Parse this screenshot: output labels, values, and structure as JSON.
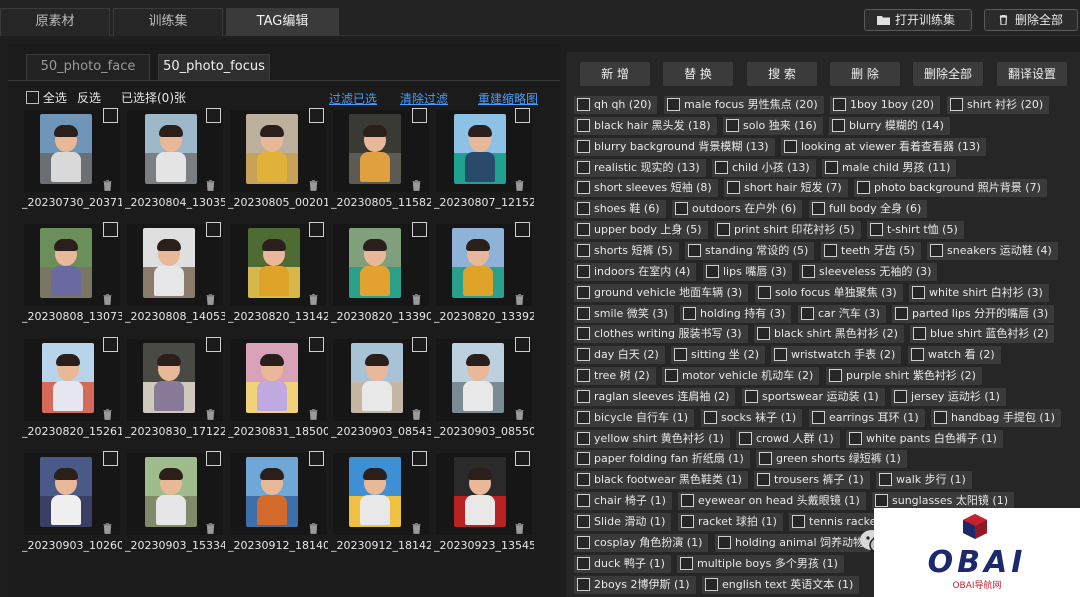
{
  "top_tabs": [
    "原素材",
    "训练集",
    "TAG编辑"
  ],
  "top_buttons": {
    "open_training": "打开训练集",
    "delete_all": "删除全部"
  },
  "sub_tabs": [
    "50_photo_face",
    "50_photo_focus"
  ],
  "controls": {
    "select_all": "全选",
    "invert": "反选",
    "selected": "已选择(0)张",
    "filter_selected": "过滤已选",
    "clear_filter": "清除过滤",
    "rebuild_thumbs": "重建缩略图"
  },
  "images": [
    "_20230730_20371",
    "_20230804_13035",
    "_20230805_00201",
    "_20230805_11582",
    "_20230807_12152",
    "_20230808_13073",
    "_20230808_14053",
    "_20230820_13142",
    "_20230820_13390",
    "_20230820_13392",
    "_20230820_15261",
    "_20230830_17122",
    "_20230831_18500",
    "_20230903_08543",
    "_20230903_08550",
    "_20230903_10260",
    "_20230903_15334",
    "_20230912_18140",
    "_20230912_18142",
    "_20230923_13545"
  ],
  "actions": [
    "新 增",
    "替 换",
    "搜 索",
    "删 除",
    "删除全部",
    "翻译设置"
  ],
  "tags": [
    [
      "qh qh (20)",
      "male focus 男性焦点 (20)",
      "1boy 1boy (20)",
      "shirt 衬衫 (20)"
    ],
    [
      "black hair 黑头发 (18)",
      "solo 独来 (16)",
      "blurry 模糊的 (14)"
    ],
    [
      "blurry background 背景模糊 (13)",
      "looking at viewer 看着查看器 (13)"
    ],
    [
      "realistic 现实的 (13)",
      "child 小孩 (13)",
      "male child 男孩 (11)"
    ],
    [
      "short sleeves 短袖 (8)",
      "short hair 短发 (7)",
      "photo background 照片背景 (7)"
    ],
    [
      "shoes 鞋 (6)",
      "outdoors 在户外 (6)",
      "full body 全身 (6)"
    ],
    [
      "upper body 上身 (5)",
      "print shirt 印花衬衫 (5)",
      "t-shirt t恤 (5)"
    ],
    [
      "shorts 短裤 (5)",
      "standing 常设的 (5)",
      "teeth 牙齿 (5)",
      "sneakers 运动鞋 (4)"
    ],
    [
      "indoors 在室内 (4)",
      "lips 嘴唇 (3)",
      "sleeveless 无袖的 (3)"
    ],
    [
      "ground vehicle 地面车辆 (3)",
      "solo focus 单独聚焦 (3)",
      "white shirt 白衬衫 (3)"
    ],
    [
      "smile 微笑 (3)",
      "holding 持有 (3)",
      "car 汽车 (3)",
      "parted lips 分开的嘴唇 (3)"
    ],
    [
      "clothes writing 服装书写 (3)",
      "black shirt 黑色衬衫 (2)",
      "blue shirt 蓝色衬衫 (2)"
    ],
    [
      "day 白天 (2)",
      "sitting 坐 (2)",
      "wristwatch 手表 (2)",
      "watch 看 (2)"
    ],
    [
      "tree 树 (2)",
      "motor vehicle 机动车 (2)",
      "purple shirt 紫色衬衫 (2)"
    ],
    [
      "raglan sleeves 连肩袖 (2)",
      "sportswear 运动装 (1)",
      "jersey 运动衫 (1)"
    ],
    [
      "bicycle 自行车 (1)",
      "socks 袜子 (1)",
      "earrings 耳环 (1)",
      "handbag 手提包 (1)"
    ],
    [
      "yellow shirt 黄色衬衫 (1)",
      "crowd 人群 (1)",
      "white pants 白色裤子 (1)"
    ],
    [
      "paper folding fan 折纸扇 (1)",
      "green shorts 绿短裤 (1)"
    ],
    [
      "black footwear 黑色鞋类 (1)",
      "trousers 裤子 (1)",
      "walk 步行 (1)"
    ],
    [
      "chair 椅子 (1)",
      "eyewear on head 头戴眼镜 (1)",
      "sunglasses 太阳镜 (1)"
    ],
    [
      "Slide 滑动 (1)",
      "racket 球拍 (1)",
      "tennis racket"
    ],
    [
      "cosplay 角色扮演 (1)",
      "holding animal 饲养动物"
    ],
    [
      "duck 鸭子 (1)",
      "multiple boys 多个男孩 (1)"
    ],
    [
      "2boys 2博伊斯 (1)",
      "english text 英语文本 (1)"
    ]
  ],
  "logo": {
    "main": "OBAI",
    "sub": "OBAI导航网"
  },
  "icons": {
    "folder": "folder-icon",
    "trash": "trash-icon",
    "chat": "wechat-icon",
    "logo": "hexagon-cube-icon"
  },
  "colors": {
    "link": "#4a9cff",
    "accent_red": "#c8202e",
    "accent_blue": "#1c2a6b"
  }
}
